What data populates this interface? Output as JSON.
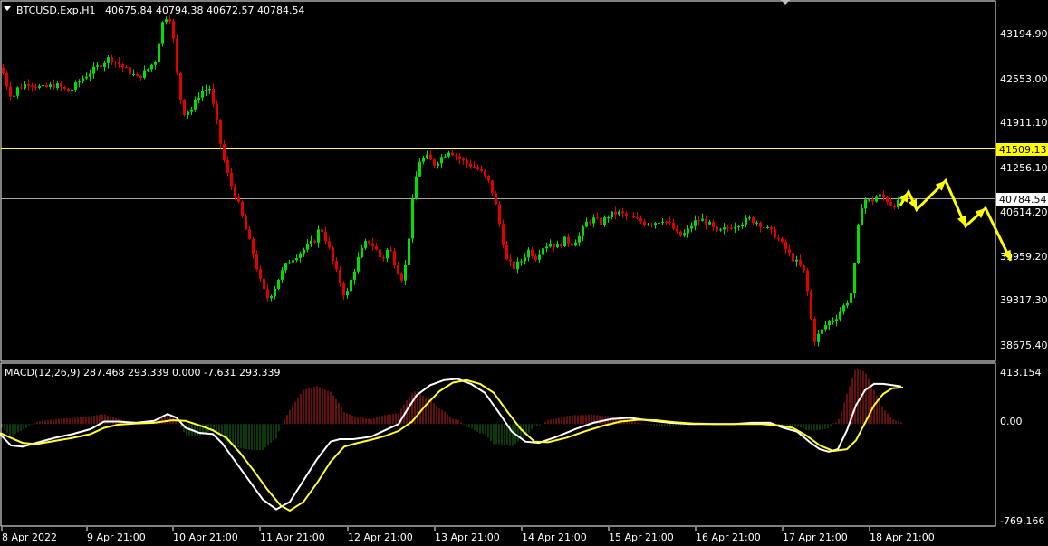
{
  "chart_data": {
    "type": "candlestick",
    "symbol_header": "BTCUSD.Exp,H1",
    "ohlc_readout": "40675.84 40794.38 40672.57 40784.54",
    "y_ticks": [
      "43194.90",
      "42553.00",
      "41911.10",
      "41256.10",
      "40614.20",
      "39959.20",
      "39317.30",
      "38675.40"
    ],
    "hlines": [
      {
        "value": 41509.13,
        "label": "41509.13",
        "color": "#ffff33",
        "label_bg": "#ffff00",
        "label_fg": "#000000"
      },
      {
        "value": 40784.54,
        "label": "40784.54",
        "color": "#a9a9a9",
        "label_bg": "#ffffff",
        "label_fg": "#000000"
      }
    ],
    "x_labels": [
      "8 Apr 2022",
      "9 Apr 21:00",
      "10 Apr 21:00",
      "11 Apr 21:00",
      "12 Apr 21:00",
      "13 Apr 21:00",
      "14 Apr 21:00",
      "15 Apr 21:00",
      "16 Apr 21:00",
      "17 Apr 21:00",
      "18 Apr 21:00"
    ],
    "price_path": [
      [
        0,
        42700
      ],
      [
        6,
        42450
      ],
      [
        12,
        42250
      ],
      [
        18,
        42400
      ],
      [
        30,
        42480
      ],
      [
        45,
        42400
      ],
      [
        60,
        42450
      ],
      [
        75,
        42350
      ],
      [
        90,
        42550
      ],
      [
        105,
        42700
      ],
      [
        120,
        42850
      ],
      [
        130,
        42750
      ],
      [
        140,
        42650
      ],
      [
        150,
        42550
      ],
      [
        160,
        42650
      ],
      [
        170,
        42800
      ],
      [
        178,
        43350
      ],
      [
        185,
        43500
      ],
      [
        190,
        43100
      ],
      [
        196,
        42350
      ],
      [
        202,
        42050
      ],
      [
        210,
        42100
      ],
      [
        220,
        42350
      ],
      [
        230,
        42400
      ],
      [
        238,
        41900
      ],
      [
        244,
        41450
      ],
      [
        252,
        41050
      ],
      [
        260,
        40800
      ],
      [
        270,
        40350
      ],
      [
        278,
        40000
      ],
      [
        286,
        39600
      ],
      [
        293,
        39350
      ],
      [
        300,
        39450
      ],
      [
        308,
        39700
      ],
      [
        318,
        39900
      ],
      [
        328,
        40000
      ],
      [
        338,
        40100
      ],
      [
        346,
        40200
      ],
      [
        352,
        40400
      ],
      [
        360,
        40150
      ],
      [
        368,
        39800
      ],
      [
        375,
        39550
      ],
      [
        380,
        39350
      ],
      [
        388,
        39700
      ],
      [
        396,
        40000
      ],
      [
        404,
        40200
      ],
      [
        412,
        40100
      ],
      [
        420,
        39900
      ],
      [
        428,
        40100
      ],
      [
        436,
        39800
      ],
      [
        444,
        39600
      ],
      [
        450,
        40250
      ],
      [
        456,
        41000
      ],
      [
        462,
        41350
      ],
      [
        470,
        41400
      ],
      [
        478,
        41300
      ],
      [
        486,
        41400
      ],
      [
        494,
        41500
      ],
      [
        500,
        41450
      ],
      [
        508,
        41350
      ],
      [
        516,
        41300
      ],
      [
        524,
        41250
      ],
      [
        532,
        41150
      ],
      [
        540,
        41000
      ],
      [
        546,
        40700
      ],
      [
        552,
        40300
      ],
      [
        558,
        39900
      ],
      [
        566,
        39800
      ],
      [
        574,
        39900
      ],
      [
        582,
        40050
      ],
      [
        590,
        39950
      ],
      [
        598,
        40100
      ],
      [
        606,
        40150
      ],
      [
        614,
        40100
      ],
      [
        622,
        40200
      ],
      [
        630,
        40150
      ],
      [
        638,
        40250
      ],
      [
        646,
        40450
      ],
      [
        654,
        40500
      ],
      [
        662,
        40450
      ],
      [
        670,
        40550
      ],
      [
        680,
        40600
      ],
      [
        690,
        40550
      ],
      [
        700,
        40500
      ],
      [
        710,
        40450
      ],
      [
        720,
        40450
      ],
      [
        730,
        40500
      ],
      [
        740,
        40400
      ],
      [
        748,
        40250
      ],
      [
        756,
        40300
      ],
      [
        764,
        40450
      ],
      [
        772,
        40500
      ],
      [
        780,
        40450
      ],
      [
        790,
        40300
      ],
      [
        798,
        40350
      ],
      [
        806,
        40400
      ],
      [
        816,
        40450
      ],
      [
        826,
        40500
      ],
      [
        836,
        40450
      ],
      [
        846,
        40350
      ],
      [
        856,
        40250
      ],
      [
        864,
        40100
      ],
      [
        872,
        39950
      ],
      [
        880,
        39850
      ],
      [
        888,
        39700
      ],
      [
        892,
        39200
      ],
      [
        898,
        38750
      ],
      [
        904,
        38850
      ],
      [
        912,
        39000
      ],
      [
        920,
        39050
      ],
      [
        928,
        39200
      ],
      [
        936,
        39350
      ],
      [
        940,
        39500
      ],
      [
        944,
        40150
      ],
      [
        948,
        40600
      ],
      [
        952,
        40800
      ],
      [
        960,
        40750
      ],
      [
        968,
        40850
      ],
      [
        976,
        40800
      ],
      [
        984,
        40700
      ],
      [
        992,
        40750
      ],
      [
        997,
        40784
      ]
    ],
    "projection_path": [
      [
        994,
        40700
      ],
      [
        1003,
        40900
      ],
      [
        1012,
        40640
      ],
      [
        1044,
        41060
      ],
      [
        1066,
        40400
      ],
      [
        1088,
        40660
      ],
      [
        1116,
        39900
      ]
    ],
    "macd": {
      "label": "MACD(12,26,9) 287.468 293.339 0.000 -7.631 293.339",
      "y_ticks": [
        "413.154",
        "0.00",
        "-769.166"
      ],
      "y_tick_values": [
        413.154,
        0.0,
        -769.166
      ],
      "ylim": [
        -769.166,
        413.154
      ],
      "histogram_color_up": "#c21e1e",
      "histogram_color_down": "#197019",
      "main_line_color": "#ffffff",
      "signal_line_color": "#ffff33",
      "main_path": [
        [
          0,
          -80
        ],
        [
          12,
          -170
        ],
        [
          25,
          -180
        ],
        [
          40,
          -150
        ],
        [
          60,
          -110
        ],
        [
          80,
          -80
        ],
        [
          100,
          -40
        ],
        [
          115,
          20
        ],
        [
          130,
          20
        ],
        [
          150,
          10
        ],
        [
          170,
          25
        ],
        [
          185,
          80
        ],
        [
          195,
          50
        ],
        [
          205,
          -30
        ],
        [
          220,
          -70
        ],
        [
          235,
          -80
        ],
        [
          245,
          -150
        ],
        [
          260,
          -300
        ],
        [
          275,
          -450
        ],
        [
          290,
          -600
        ],
        [
          305,
          -680
        ],
        [
          320,
          -620
        ],
        [
          335,
          -450
        ],
        [
          350,
          -280
        ],
        [
          365,
          -140
        ],
        [
          375,
          -120
        ],
        [
          390,
          -120
        ],
        [
          410,
          -100
        ],
        [
          425,
          -50
        ],
        [
          440,
          0
        ],
        [
          450,
          120
        ],
        [
          460,
          230
        ],
        [
          475,
          310
        ],
        [
          490,
          350
        ],
        [
          505,
          360
        ],
        [
          520,
          320
        ],
        [
          535,
          250
        ],
        [
          550,
          100
        ],
        [
          565,
          -60
        ],
        [
          580,
          -140
        ],
        [
          595,
          -150
        ],
        [
          615,
          -100
        ],
        [
          635,
          -40
        ],
        [
          655,
          10
        ],
        [
          675,
          40
        ],
        [
          695,
          50
        ],
        [
          715,
          30
        ],
        [
          740,
          10
        ],
        [
          765,
          0
        ],
        [
          790,
          0
        ],
        [
          810,
          0
        ],
        [
          830,
          10
        ],
        [
          850,
          10
        ],
        [
          865,
          -30
        ],
        [
          880,
          -60
        ],
        [
          895,
          -150
        ],
        [
          905,
          -200
        ],
        [
          915,
          -220
        ],
        [
          925,
          -200
        ],
        [
          935,
          -50
        ],
        [
          945,
          150
        ],
        [
          955,
          270
        ],
        [
          965,
          320
        ],
        [
          975,
          320
        ],
        [
          985,
          310
        ],
        [
          995,
          300
        ]
      ],
      "signal_path": [
        [
          0,
          -70
        ],
        [
          12,
          -110
        ],
        [
          25,
          -150
        ],
        [
          40,
          -160
        ],
        [
          60,
          -135
        ],
        [
          80,
          -110
        ],
        [
          100,
          -80
        ],
        [
          115,
          -30
        ],
        [
          130,
          -5
        ],
        [
          150,
          5
        ],
        [
          170,
          10
        ],
        [
          190,
          30
        ],
        [
          205,
          25
        ],
        [
          220,
          -10
        ],
        [
          235,
          -50
        ],
        [
          250,
          -110
        ],
        [
          265,
          -230
        ],
        [
          280,
          -370
        ],
        [
          295,
          -520
        ],
        [
          310,
          -650
        ],
        [
          320,
          -690
        ],
        [
          335,
          -620
        ],
        [
          350,
          -470
        ],
        [
          365,
          -300
        ],
        [
          380,
          -180
        ],
        [
          395,
          -150
        ],
        [
          410,
          -125
        ],
        [
          425,
          -95
        ],
        [
          440,
          -55
        ],
        [
          455,
          20
        ],
        [
          470,
          150
        ],
        [
          485,
          260
        ],
        [
          500,
          330
        ],
        [
          515,
          350
        ],
        [
          530,
          320
        ],
        [
          545,
          250
        ],
        [
          560,
          100
        ],
        [
          575,
          -40
        ],
        [
          590,
          -140
        ],
        [
          605,
          -145
        ],
        [
          625,
          -110
        ],
        [
          645,
          -60
        ],
        [
          665,
          -15
        ],
        [
          685,
          20
        ],
        [
          705,
          35
        ],
        [
          725,
          30
        ],
        [
          745,
          15
        ],
        [
          765,
          5
        ],
        [
          790,
          0
        ],
        [
          815,
          0
        ],
        [
          840,
          0
        ],
        [
          860,
          -10
        ],
        [
          875,
          -30
        ],
        [
          890,
          -90
        ],
        [
          905,
          -170
        ],
        [
          920,
          -215
        ],
        [
          935,
          -200
        ],
        [
          945,
          -130
        ],
        [
          955,
          10
        ],
        [
          965,
          150
        ],
        [
          975,
          240
        ],
        [
          985,
          285
        ],
        [
          997,
          293
        ]
      ]
    }
  }
}
